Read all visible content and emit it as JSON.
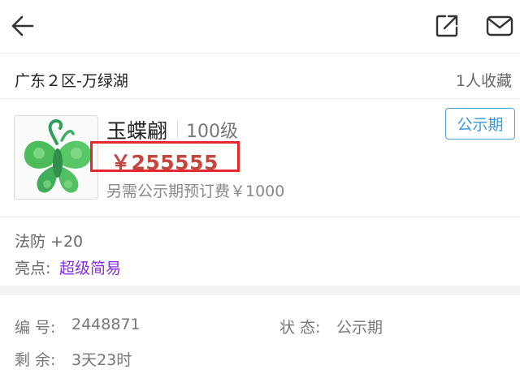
{
  "header": {
    "back_icon": "arrow-left-icon",
    "share_icon": "share-external-icon",
    "mail_icon": "mail-envelope-icon"
  },
  "server": {
    "name": "广东２区-万绿湖",
    "favorites": "1人收藏"
  },
  "item": {
    "name": "玉蝶翩",
    "level": "100级",
    "price": "￥255555",
    "fee": "另需公示期预订费￥1000",
    "status_button": "公示期",
    "thumbnail_icon": "jade-butterfly-pendant-icon"
  },
  "attributes": {
    "magic_defense": "法防 +20",
    "highlight_label": "亮点:",
    "highlight_value": "超级简易"
  },
  "info": {
    "id_label": "编 号:",
    "id_value": "2448871",
    "state_label": "状 态:",
    "state_value": "公示期",
    "remaining_label": "剩 余:",
    "remaining_value": "3天23时"
  },
  "colors": {
    "price": "#c4473f",
    "price_box": "#e5292c",
    "status_button": "#3b97d8",
    "highlight": "#8a2be2"
  }
}
